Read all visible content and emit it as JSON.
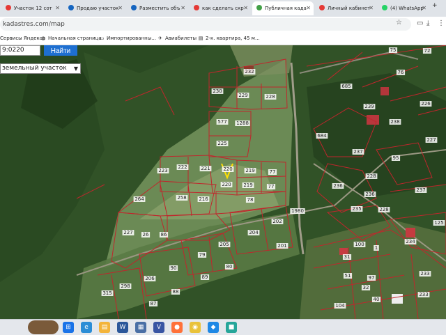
{
  "tabs": [
    {
      "label": "Участок 12 сот",
      "color": "#e53935",
      "active": false
    },
    {
      "label": "Продаю участок",
      "color": "#1565c0",
      "active": false
    },
    {
      "label": "Разместить объ",
      "color": "#1565c0",
      "active": false
    },
    {
      "label": "как сделать скр",
      "color": "#e53935",
      "active": false
    },
    {
      "label": "Публичная када",
      "color": "#43a047",
      "active": true
    },
    {
      "label": "Личный кабинет",
      "color": "#e53935",
      "active": false
    },
    {
      "label": "(4) WhatsApp",
      "color": "#25d366",
      "active": false
    }
  ],
  "address": {
    "url": "kadastres.com/map"
  },
  "bookmarks": [
    {
      "label": "Сервисы Яндекса",
      "icon": "grid-icon"
    },
    {
      "label": "Начальная страница",
      "icon": "globe-icon"
    },
    {
      "label": "Импортированны...",
      "icon": "folder-icon"
    },
    {
      "label": "Авиабилеты",
      "icon": "plane-icon"
    },
    {
      "label": "2-к. квартира, 45 м...",
      "icon": "page-icon"
    }
  ],
  "map": {
    "search_value": "9:0220",
    "find_button": "Найти",
    "type_select": "земельный участок",
    "parcel_labels": [
      "232",
      "230",
      "229",
      "228",
      "577",
      "1288",
      "225",
      "223",
      "222",
      "221",
      "220",
      "219",
      "77",
      "220",
      "219",
      "77",
      "264",
      "258",
      "216",
      "78",
      "202",
      "204",
      "1980",
      "227",
      "26",
      "86",
      "205",
      "201",
      "79",
      "90",
      "206",
      "89",
      "80",
      "88",
      "298",
      "87",
      "315",
      "75",
      "72",
      "76",
      "685",
      "239",
      "226",
      "238",
      "684",
      "237",
      "227",
      "95",
      "236",
      "228",
      "237",
      "236",
      "235",
      "228",
      "125",
      "234",
      "100",
      "1",
      "233",
      "31",
      "51",
      "97",
      "32",
      "104",
      "40",
      "233"
    ]
  },
  "taskbar": {
    "icons": [
      "windows-start-icon",
      "edge-icon",
      "file-explorer-icon",
      "word-icon",
      "store-icon",
      "visio-icon",
      "firefox-icon",
      "chrome-icon",
      "shield-icon",
      "app-icon"
    ]
  },
  "colors": {
    "accent": "#1e6fd1",
    "parcel_border": "#c0262c",
    "highlight": "#ffe000"
  }
}
